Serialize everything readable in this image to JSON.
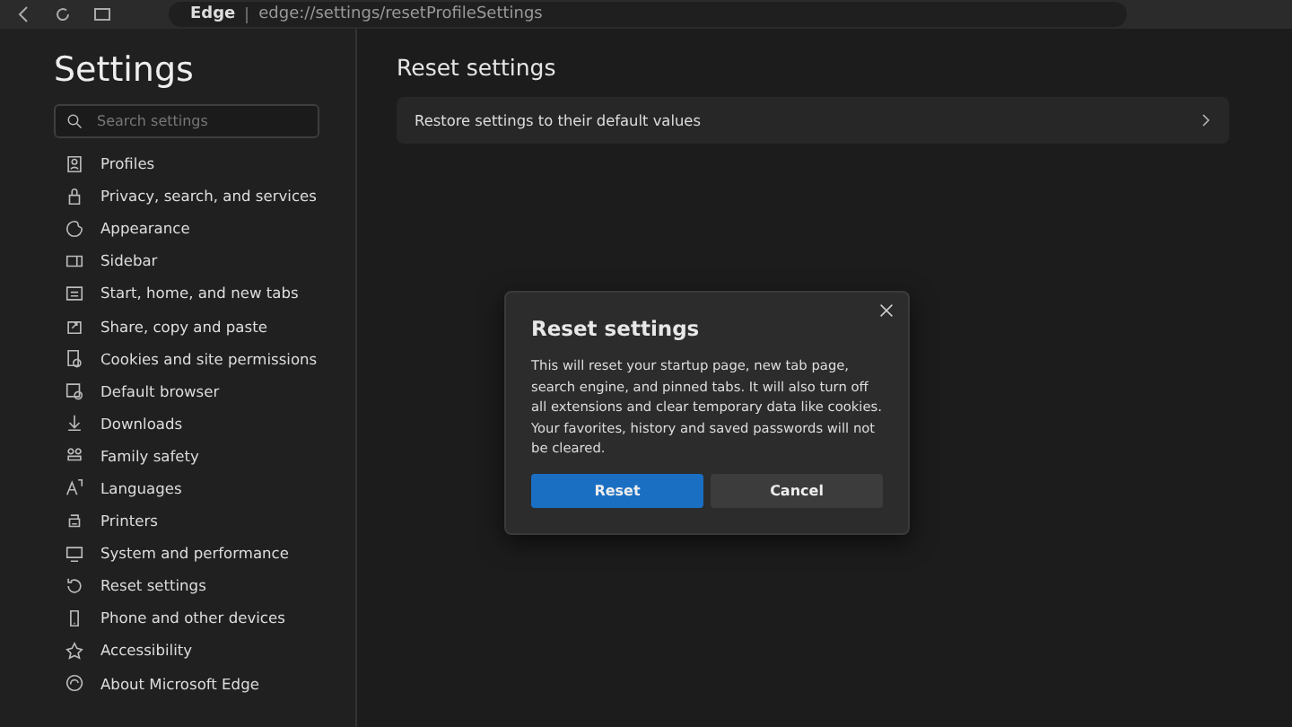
{
  "browser": {
    "site_label": "Edge",
    "url": "edge://settings/resetProfileSettings"
  },
  "sidebar": {
    "title": "Settings",
    "search": {
      "placeholder": "Search settings"
    },
    "items": [
      {
        "label": "Profiles"
      },
      {
        "label": "Privacy, search, and services"
      },
      {
        "label": "Appearance"
      },
      {
        "label": "Sidebar"
      },
      {
        "label": "Start, home, and new tabs"
      },
      {
        "label": "Share, copy and paste"
      },
      {
        "label": "Cookies and site permissions"
      },
      {
        "label": "Default browser"
      },
      {
        "label": "Downloads"
      },
      {
        "label": "Family safety"
      },
      {
        "label": "Languages"
      },
      {
        "label": "Printers"
      },
      {
        "label": "System and performance"
      },
      {
        "label": "Reset settings"
      },
      {
        "label": "Phone and other devices"
      },
      {
        "label": "Accessibility"
      },
      {
        "label": "About Microsoft Edge"
      }
    ]
  },
  "main": {
    "title": "Reset settings",
    "rows": [
      {
        "label": "Restore settings to their default values"
      }
    ]
  },
  "dialog": {
    "title": "Reset settings",
    "body": "This will reset your startup page, new tab page, search engine, and pinned tabs. It will also turn off all extensions and clear temporary data like cookies. Your favorites, history and saved passwords will not be cleared.",
    "buttons": [
      {
        "label": "Reset",
        "kind": "primary"
      },
      {
        "label": "Cancel",
        "kind": "secondary"
      }
    ]
  }
}
